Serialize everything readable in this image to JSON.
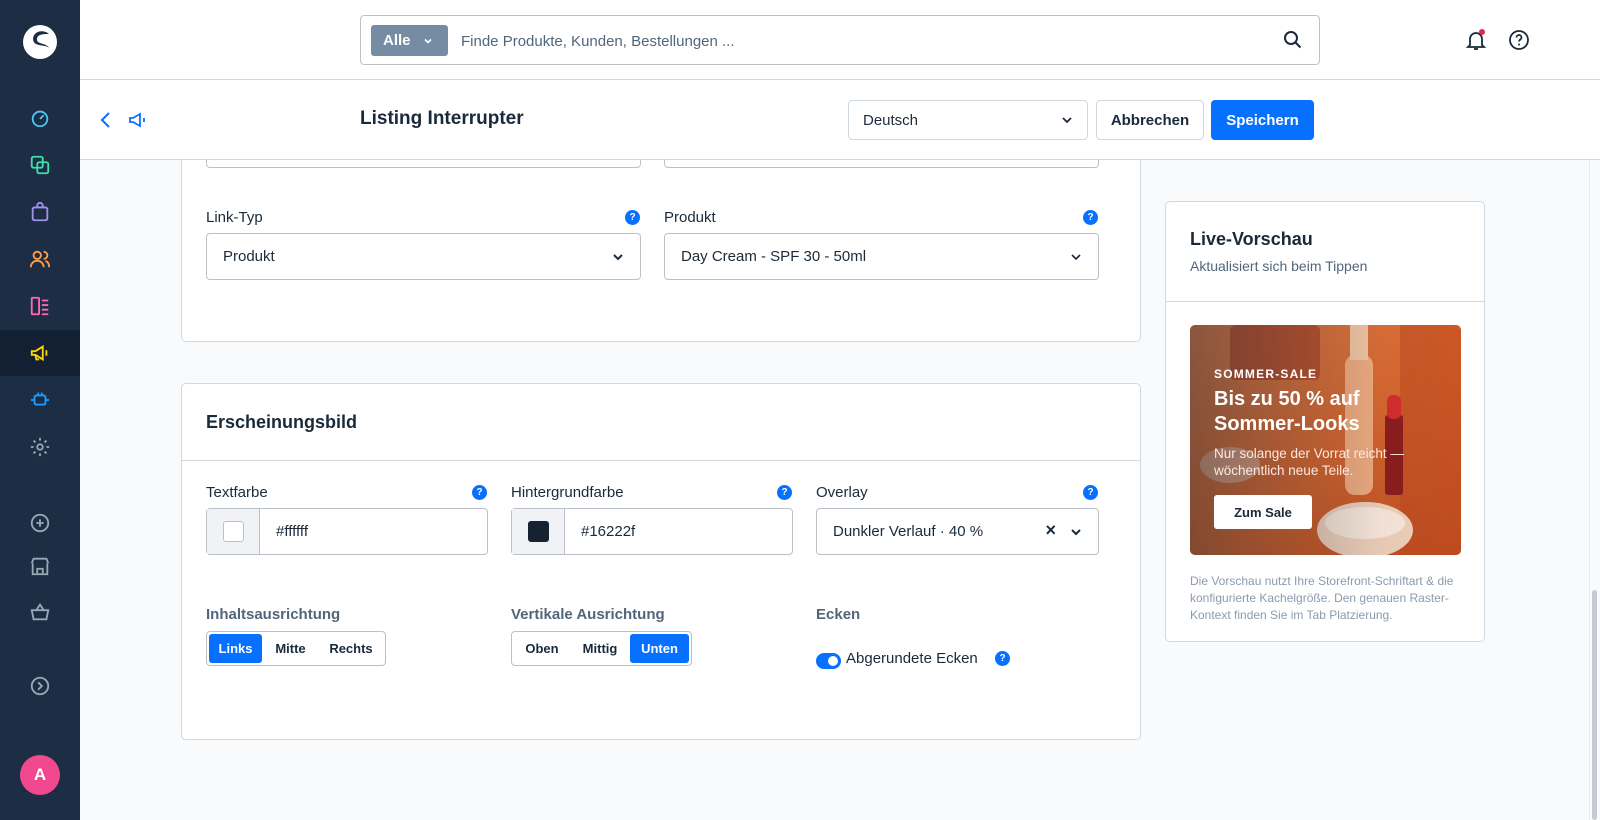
{
  "user": {
    "initial": "A"
  },
  "search": {
    "type_label": "Alle",
    "placeholder": "Finde Produkte, Kunden, Bestellungen ..."
  },
  "smartbar": {
    "title": "Listing Interrupter",
    "language": "Deutsch",
    "cancel_label": "Abbrechen",
    "save_label": "Speichern"
  },
  "link_card": {
    "link_type": {
      "label": "Link-Typ",
      "value": "Produkt"
    },
    "product": {
      "label": "Produkt",
      "value": "Day Cream - SPF 30 - 50ml"
    }
  },
  "appearance": {
    "title": "Erscheinungsbild",
    "text_color": {
      "label": "Textfarbe",
      "value": "#ffffff"
    },
    "bg_color": {
      "label": "Hintergrundfarbe",
      "value": "#16222f"
    },
    "overlay": {
      "label": "Overlay",
      "value": "Dunkler Verlauf · 40 %",
      "clear": "×"
    },
    "content_alignment": {
      "label": "Inhaltsausrichtung",
      "options": [
        "Links",
        "Mitte",
        "Rechts"
      ],
      "selected": "Links"
    },
    "vertical_alignment": {
      "label": "Vertikale Ausrichtung",
      "options": [
        "Oben",
        "Mittig",
        "Unten"
      ],
      "selected": "Unten"
    },
    "corners": {
      "label": "Ecken",
      "toggle_label": "Abgerundete Ecken",
      "enabled": true
    }
  },
  "preview": {
    "title": "Live-Vorschau",
    "subtitle": "Aktualisiert sich beim Tippen",
    "eyebrow": "SOMMER-SALE",
    "headline": "Bis zu 50 % auf Sommer-Looks",
    "body": "Nur solange der Vorrat reicht — wöchentlich neue Teile.",
    "cta": "Zum Sale",
    "note": "Die Vorschau nutzt Ihre Storefront-Schriftart & die konfigurierte Kachelgröße. Den genauen Raster-Kontext finden Sie im Tab Platzierung."
  },
  "colors": {
    "primary": "#0870ff",
    "sidebar": "#1d2d44",
    "avatar": "#f0498f",
    "notification_dot": "#de294c"
  },
  "icons": {
    "sidebar": [
      "dashboard-icon",
      "catalogue-icon",
      "orders-icon",
      "customers-icon",
      "content-icon",
      "marketing-icon",
      "extensions-icon",
      "settings-icon",
      "add-icon",
      "sales-channel-icon",
      "shop-icon",
      "expand-icon"
    ]
  }
}
